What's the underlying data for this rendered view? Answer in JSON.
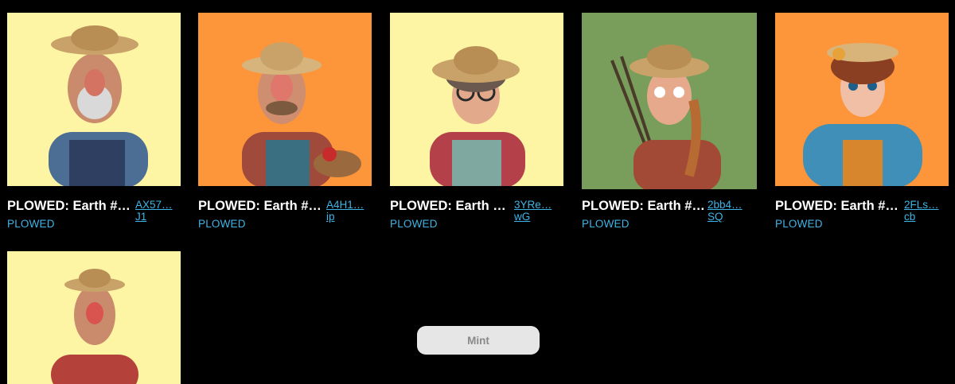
{
  "cards": [
    {
      "title": "PLOWED: Earth #…",
      "collection": "PLOWED",
      "addr_line1": "AX57…",
      "addr_line2": "J1",
      "bg": "#fdf5a3"
    },
    {
      "title": "PLOWED: Earth #…",
      "collection": "PLOWED",
      "addr_line1": "A4H1…",
      "addr_line2": "ip",
      "bg": "#fd953a"
    },
    {
      "title": "PLOWED: Earth …",
      "collection": "PLOWED",
      "addr_line1": "3YRe…",
      "addr_line2": "wG",
      "bg": "#fdf5a3"
    },
    {
      "title": "PLOWED: Earth #…",
      "collection": "PLOWED",
      "addr_line1": "2bb4…",
      "addr_line2": "SQ",
      "bg": "#799d5a"
    },
    {
      "title": "PLOWED: Earth #…",
      "collection": "PLOWED",
      "addr_line1": "2FLs…",
      "addr_line2": "cb",
      "bg": "#fd953a"
    },
    {
      "bg": "#fdf5a3"
    }
  ],
  "mint_button": {
    "label": "Mint"
  },
  "colors": {
    "link": "#3fb4e6",
    "background": "#000000"
  }
}
